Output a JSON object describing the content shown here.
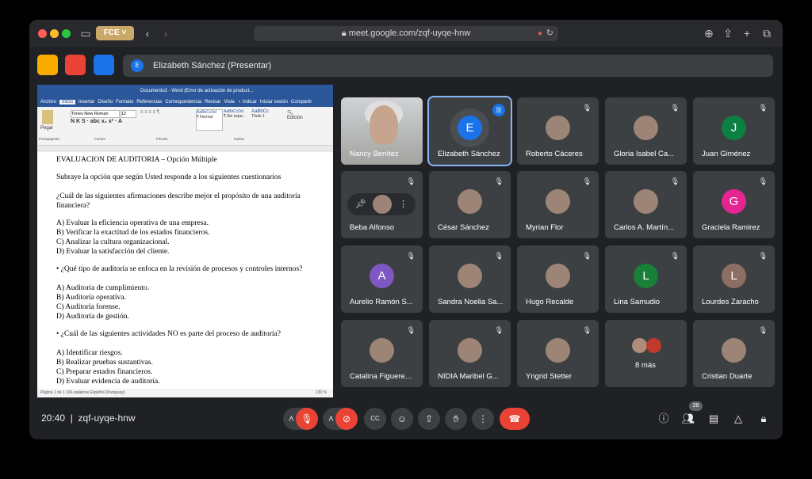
{
  "browser": {
    "profile_label": "FCE",
    "url": "meet.google.com/zqf-uyqe-hnw"
  },
  "presenting": {
    "avatar_letter": "E",
    "label": "Elizabeth Sánchez (Presentar)"
  },
  "word": {
    "title": "Documento2 - Word (Error de activación de product...",
    "tabs": [
      "Archivo",
      "Inicio",
      "Insertar",
      "Diseño",
      "Formato",
      "Referencias",
      "Correspondencia",
      "Revisar",
      "Vista",
      "♀ Indicar",
      "Iniciar sesión",
      "Compartir"
    ],
    "font_name": "Times New Roman",
    "font_size": "12",
    "styles": [
      "¶ Normal",
      "¶ Sin espa...",
      "Título 1"
    ],
    "groups": [
      "Portapapeles",
      "Fuente",
      "Párrafo",
      "Estilos",
      "Edición"
    ],
    "paste_label": "Pegar",
    "status_left": "Página 1 de 1     166 palabras     Español (Paraguay)",
    "zoom": "130 %",
    "lines": [
      "EVALUACION DE AUDITORIA – Opción Múltiple",
      "Subraye la opción que según Usted responde a los siguientes cuestionarios",
      "¿Cuál de las siguientes afirmaciones describe mejor el propósito de una auditoría",
      "financiera?",
      "A) Evaluar la eficiencia operativa de una empresa.",
      "B) Verificar la exactitud de los estados financieros.",
      "C) Analizar la cultura organizacional.",
      "D) Evaluar la satisfacción del cliente.",
      "•  ¿Qué tipo de auditoría se enfoca en la revisión de procesos y controles internos?",
      "A) Auditoría de cumplimiento.",
      "B) Auditoría operativa.",
      "C) Auditoría forense.",
      "D) Auditoría de gestión.",
      "•  ¿Cuál de las siguientes actividades NO es parte del proceso de auditoría?",
      "A) Identificar riesgos.",
      "B) Realizar pruebas sustantivas.",
      "C) Preparar estados financieros.",
      "D) Evaluar evidencia de auditoría."
    ]
  },
  "participants": [
    {
      "name": "Nancy Benítez",
      "type": "video"
    },
    {
      "name": "Elizabeth Sánchez",
      "letter": "E",
      "type": "speaking"
    },
    {
      "name": "Roberto Cáceres",
      "type": "photo"
    },
    {
      "name": "Gloria Isabel Ca...",
      "type": "photo"
    },
    {
      "name": "Juan Giménez",
      "letter": "J",
      "type": "letter"
    },
    {
      "name": "Beba Alfonso",
      "type": "pinned"
    },
    {
      "name": "César Sánchez",
      "type": "photo"
    },
    {
      "name": "Myrian Flor",
      "type": "photo"
    },
    {
      "name": "Carlos A. Martín...",
      "type": "photo"
    },
    {
      "name": "Graciela Ramirez",
      "letter": "G",
      "type": "letter"
    },
    {
      "name": "Aurelio Ramón S...",
      "letter": "A",
      "type": "letter"
    },
    {
      "name": "Sandra Noelia Sa...",
      "type": "photo"
    },
    {
      "name": "Hugo Recalde",
      "type": "photo"
    },
    {
      "name": "Lina Samudio",
      "letter": "L",
      "type": "letter"
    },
    {
      "name": "Lourdes Zaracho",
      "letter": "L",
      "type": "letter"
    },
    {
      "name": "Catalina Figuere...",
      "type": "photo"
    },
    {
      "name": "NIDIA Maribel G...",
      "type": "photo"
    },
    {
      "name": "Yngrid Stetter",
      "type": "photo"
    },
    {
      "name": "8 más",
      "type": "more"
    },
    {
      "name": "Cristian Duarte",
      "type": "photo"
    }
  ],
  "colors": {
    "avatar_E": "#1a73e8",
    "avatar_J": "#0b8043",
    "avatar_G": "#e52592",
    "avatar_A": "#7e57c2",
    "avatar_L_green": "#188038",
    "avatar_L_brown": "#8d6e63",
    "danger": "#ea4335",
    "accent": "#8ab4f8"
  },
  "meeting": {
    "time": "20:40",
    "code": "zqf-uyqe-hnw",
    "participant_count": "28"
  }
}
